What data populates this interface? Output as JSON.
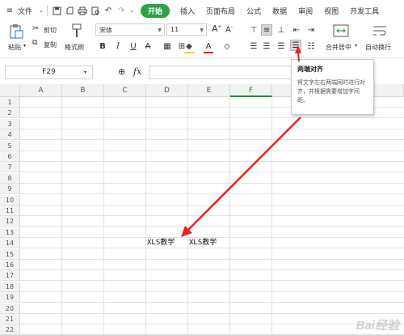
{
  "menu": {
    "file": "文件",
    "tabs": [
      "开始",
      "插入",
      "页面布局",
      "公式",
      "数据",
      "审阅",
      "视图"
    ],
    "more": "开发工具"
  },
  "ribbon": {
    "paste": "粘贴",
    "cut": "剪切",
    "copy": "复制",
    "format_painter": "格式刷",
    "font_name": "宋体",
    "font_size": "11",
    "merge_center": "合并居中",
    "wrap_text": "自动换行"
  },
  "formula_bar": {
    "name_box": "F29",
    "fx": "fx"
  },
  "grid": {
    "columns": [
      "A",
      "B",
      "C",
      "D",
      "E",
      "F"
    ],
    "rows": [
      "1",
      "2",
      "3",
      "4",
      "5",
      "6",
      "7",
      "8",
      "9",
      "10",
      "11",
      "12",
      "13",
      "14",
      "15",
      "16",
      "17",
      "18",
      "19",
      "20",
      "21",
      "22"
    ],
    "cell_d14": "XLS教学",
    "cell_e14": "XLS教学"
  },
  "tooltip": {
    "title": "两端对齐",
    "body": "将文字左右两端同时进行对齐，并根据需要增加字间距。"
  },
  "watermark": "Bai经验",
  "colors": {
    "accent": "#2ba245",
    "arrow": "#e8231d",
    "active_column": "#1a8f3a"
  }
}
